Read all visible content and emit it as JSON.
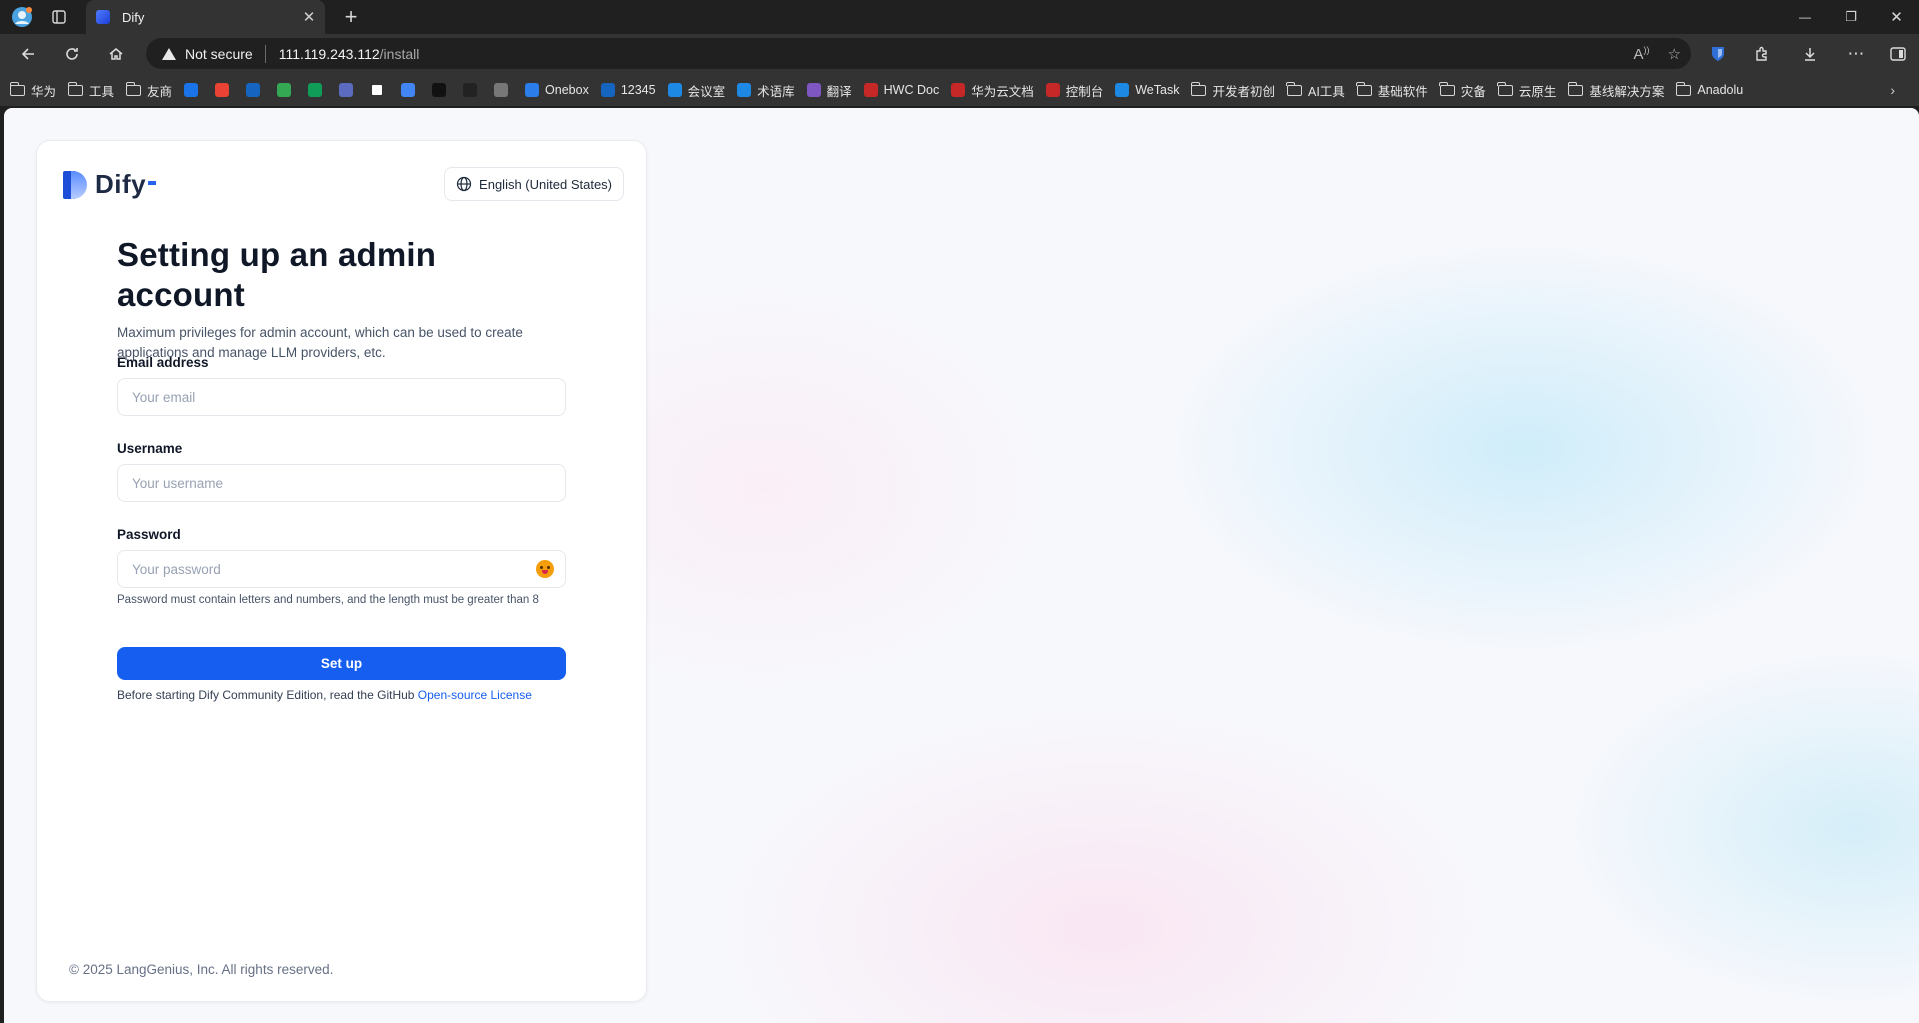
{
  "browser": {
    "tab": {
      "title": "Dify",
      "close": "✕"
    },
    "new_tab": "+",
    "window_controls": {
      "minimize": "—",
      "restore": "❐",
      "close": "✕"
    },
    "address": {
      "security_label": "Not secure",
      "host": "111.119.243.112",
      "path": "/install"
    },
    "bookmarks": [
      {
        "label": "华为",
        "type": "folder"
      },
      {
        "label": "工具",
        "type": "folder"
      },
      {
        "label": "友商",
        "type": "folder"
      },
      {
        "label": "",
        "type": "site",
        "color": "#1a73e8"
      },
      {
        "label": "",
        "type": "site",
        "color": "#ea4335"
      },
      {
        "label": "",
        "type": "site",
        "color": "#1565c0"
      },
      {
        "label": "",
        "type": "site",
        "color": "#34a853"
      },
      {
        "label": "",
        "type": "site",
        "color": "#0f9d58"
      },
      {
        "label": "",
        "type": "site",
        "color": "#5c6bc0"
      },
      {
        "label": "",
        "type": "site",
        "color": "#ffffff"
      },
      {
        "label": "",
        "type": "site",
        "color": "#4285f4"
      },
      {
        "label": "",
        "type": "site",
        "color": "#111111"
      },
      {
        "label": "",
        "type": "site",
        "color": "#222222"
      },
      {
        "label": "",
        "type": "site",
        "color": "#777777"
      },
      {
        "label": "Onebox",
        "type": "site",
        "color": "#2b7de9"
      },
      {
        "label": "12345",
        "type": "site",
        "color": "#1565c0"
      },
      {
        "label": "会议室",
        "type": "site",
        "color": "#1e88e5"
      },
      {
        "label": "术语库",
        "type": "site",
        "color": "#1e88e5"
      },
      {
        "label": "翻译",
        "type": "site",
        "color": "#7e57c2"
      },
      {
        "label": "HWC Doc",
        "type": "site",
        "color": "#c62828"
      },
      {
        "label": "华为云文档",
        "type": "site",
        "color": "#c62828"
      },
      {
        "label": "控制台",
        "type": "site",
        "color": "#c62828"
      },
      {
        "label": "WeTask",
        "type": "site",
        "color": "#1e88e5"
      },
      {
        "label": "开发者初创",
        "type": "folder"
      },
      {
        "label": "AI工具",
        "type": "folder"
      },
      {
        "label": "基础软件",
        "type": "folder"
      },
      {
        "label": "灾备",
        "type": "folder"
      },
      {
        "label": "云原生",
        "type": "folder"
      },
      {
        "label": "基线解决方案",
        "type": "folder"
      },
      {
        "label": "Anadolu",
        "type": "folder"
      }
    ],
    "bookmarks_more": "›"
  },
  "page": {
    "logo_text": "Dify",
    "language_button": "English (United States)",
    "title": "Setting up an admin account",
    "subtitle": "Maximum privileges for admin account, which can be used to create applications and manage LLM providers, etc.",
    "email": {
      "label": "Email address",
      "placeholder": "Your email",
      "value": ""
    },
    "username": {
      "label": "Username",
      "placeholder": "Your username",
      "value": ""
    },
    "password": {
      "label": "Password",
      "placeholder": "Your password",
      "value": "",
      "hint": "Password must contain letters and numbers, and the length must be greater than 8"
    },
    "setup_button": "Set up",
    "license_text": "Before starting Dify Community Edition, read the GitHub ",
    "license_link": "Open-source License",
    "copyright": "© 2025 LangGenius, Inc. All rights reserved.",
    "colors": {
      "primary": "#155eef",
      "brand": "#1d4ed8"
    }
  }
}
